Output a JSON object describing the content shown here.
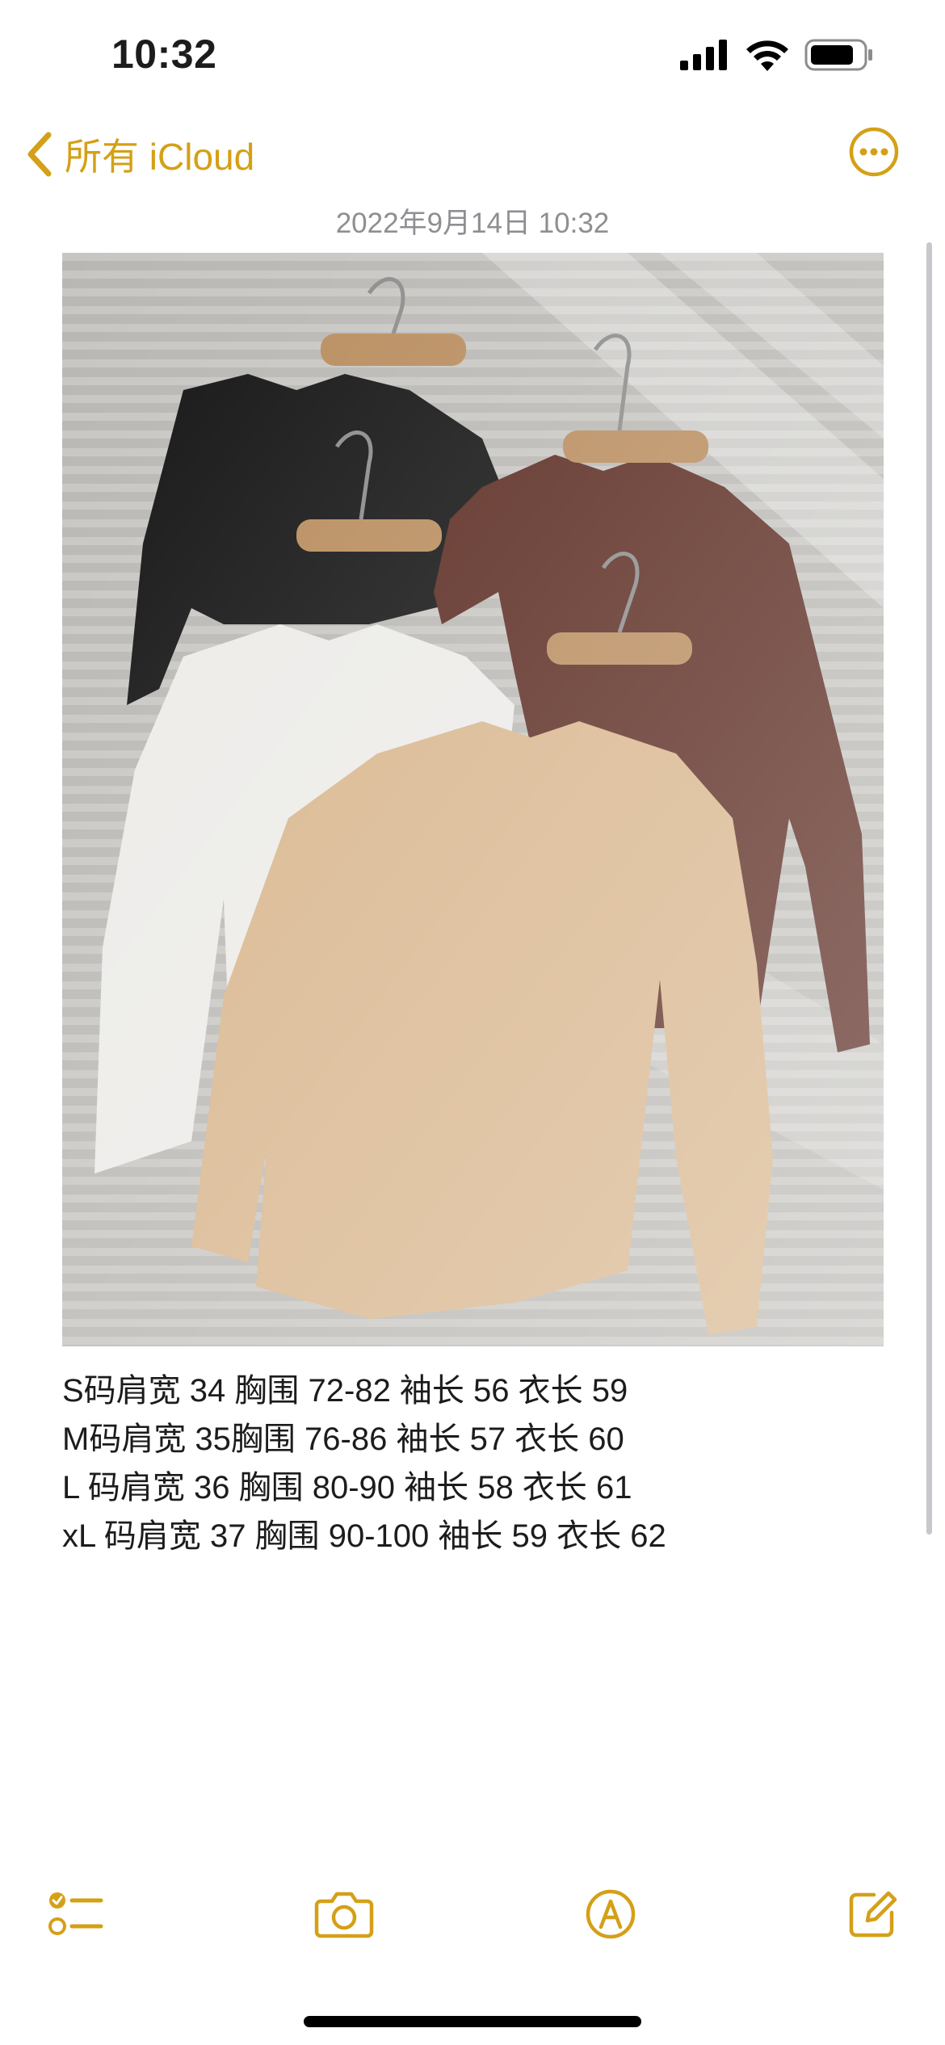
{
  "status_bar": {
    "time": "10:32"
  },
  "nav": {
    "back_label": "所有 iCloud",
    "back_icon": "chevron-left-icon",
    "more_icon": "ellipsis-circle-icon"
  },
  "note": {
    "date": "2022年9月14日 10:32",
    "photo_subject": "four long-sleeve tops on hangers",
    "lines": [
      "S码肩宽 34 胸围 72-82 袖长 56 衣长 59",
      "M码肩宽 35胸围 76-86 袖长 57 衣长 60",
      "L 码肩宽 36 胸围 80-90 袖长 58 衣长 61",
      "xL 码肩宽 37 胸围 90-100 袖长 59 衣长 62"
    ]
  },
  "toolbar": {
    "checklist_icon": "checklist-icon",
    "camera_icon": "camera-icon",
    "markup_icon": "markup-pen-icon",
    "compose_icon": "compose-icon"
  },
  "colors": {
    "accent": "#d4a017",
    "date_text": "#8e8e93",
    "body_text": "#1c1c1e",
    "background": "#ffffff"
  }
}
